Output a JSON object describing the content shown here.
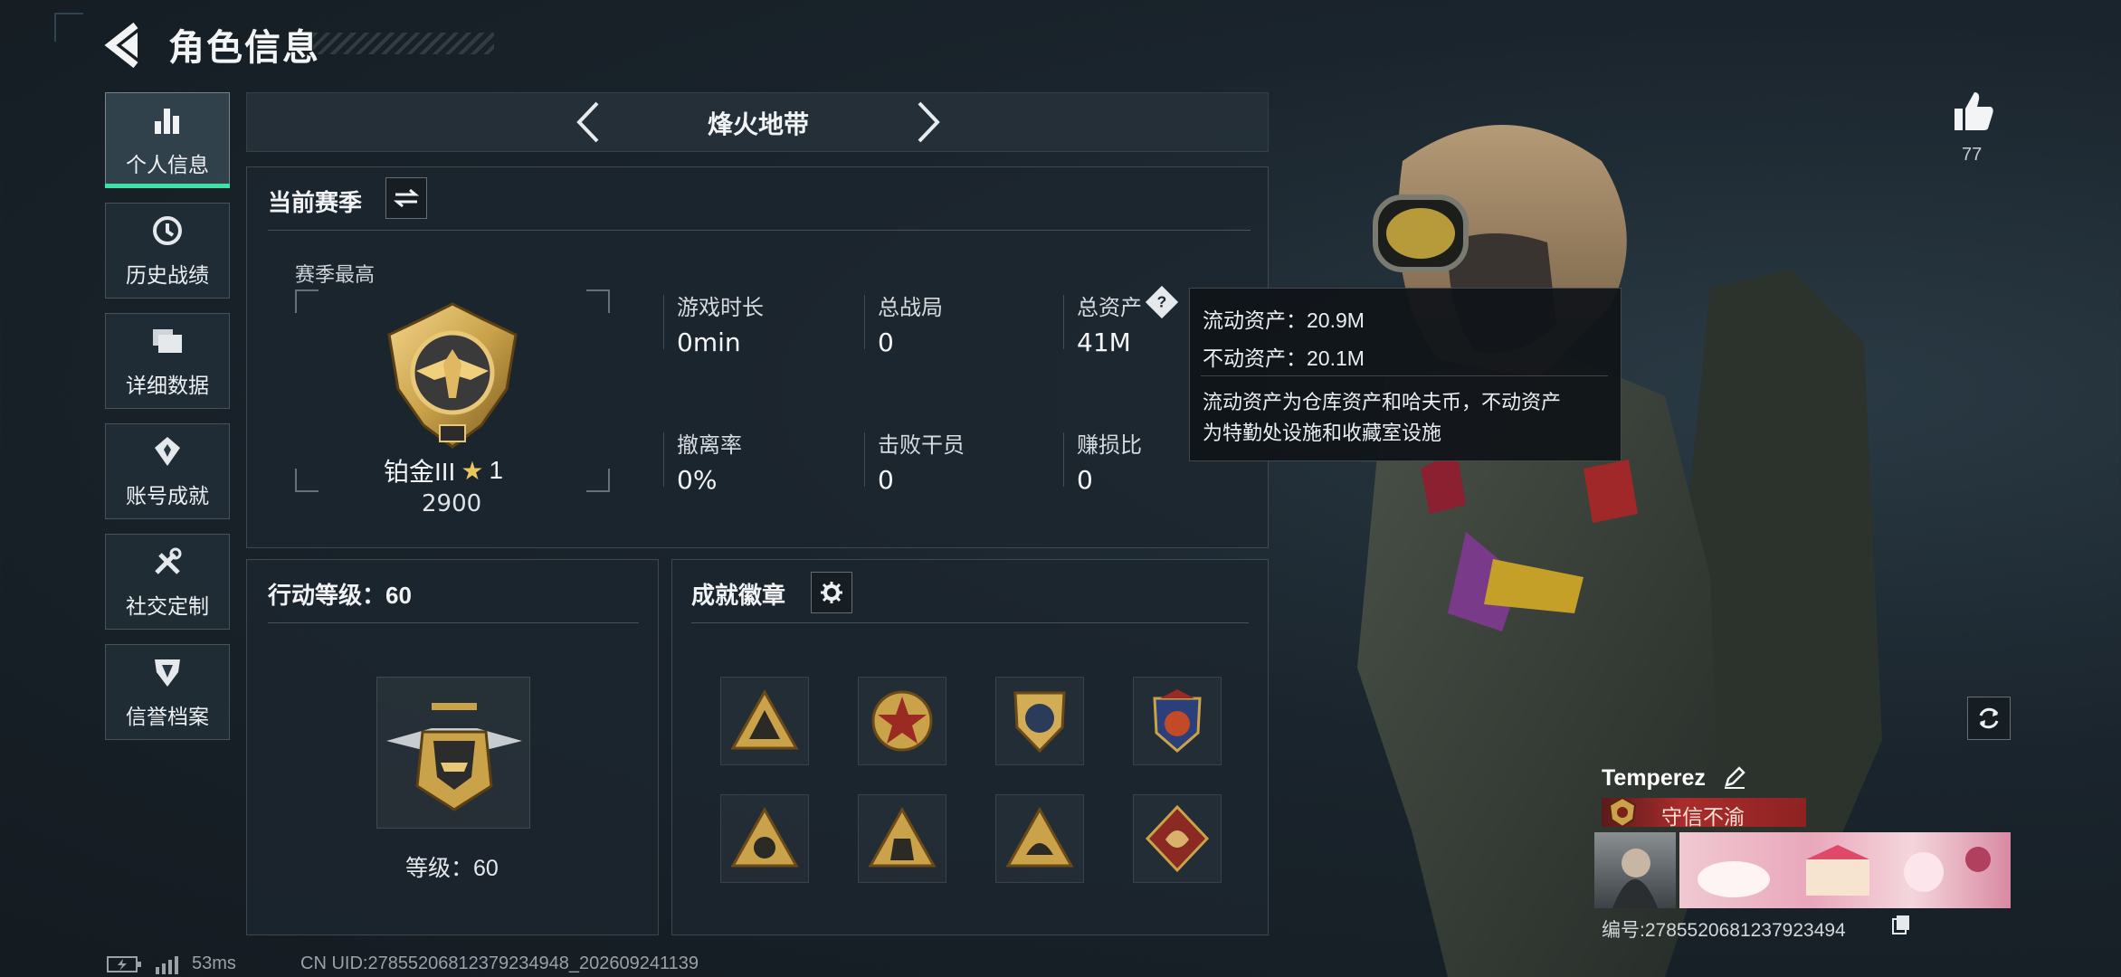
{
  "header": {
    "title": "角色信息"
  },
  "sidebar": {
    "items": [
      {
        "label": "个人信息",
        "icon": "bar-chart-icon",
        "active": true
      },
      {
        "label": "历史战绩",
        "icon": "history-clock-icon",
        "active": false
      },
      {
        "label": "详细数据",
        "icon": "folder-icon",
        "active": false
      },
      {
        "label": "账号成就",
        "icon": "achievement-icon",
        "active": false
      },
      {
        "label": "社交定制",
        "icon": "tools-icon",
        "active": false
      },
      {
        "label": "信誉档案",
        "icon": "credit-shield-icon",
        "active": false
      }
    ]
  },
  "mode": {
    "title": "烽火地带"
  },
  "season": {
    "title": "当前赛季",
    "best_label": "赛季最高",
    "rank_name": "铂金III",
    "rank_stars": "1",
    "rank_points": "2900",
    "stats": [
      {
        "label": "游戏时长",
        "value": "0min"
      },
      {
        "label": "总战局",
        "value": "0"
      },
      {
        "label": "总资产",
        "value": "41M"
      },
      {
        "label": "撤离率",
        "value": "0%"
      },
      {
        "label": "击败干员",
        "value": "0"
      },
      {
        "label": "赚损比",
        "value": "0"
      }
    ]
  },
  "tooltip": {
    "line1": "流动资产：20.9M",
    "line2": "不动资产：20.1M",
    "desc1": "流动资产为仓库资产和哈夫币，不动资产",
    "desc2": "为特勤处设施和收藏室设施"
  },
  "action_level": {
    "title": "行动等级：60",
    "level_text": "等级：60"
  },
  "achievements": {
    "title": "成就徽章",
    "badges": [
      "badge-1",
      "badge-2",
      "badge-3",
      "badge-4",
      "badge-5",
      "badge-6",
      "badge-7",
      "badge-8"
    ]
  },
  "likes": {
    "count": "77"
  },
  "player": {
    "name": "Temperez",
    "title": "守信不渝",
    "id_line": "编号:2785520681237923494"
  },
  "status": {
    "ping": "53ms",
    "uid": "CN UID:27855206812379234948_202609241139"
  },
  "colors": {
    "accent": "#3fe2a6",
    "title_banner": "#a92c2c",
    "gold": "#c9a24a"
  }
}
